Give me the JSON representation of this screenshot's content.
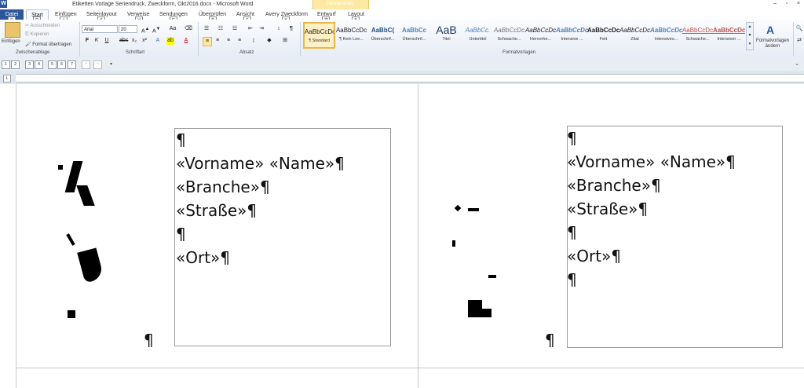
{
  "window": {
    "title": "Etiketten Vorlage Seriendruck, Zweckform, Okt2016.docx - Microsoft Word",
    "app_icon": "W",
    "context_tab_group": "Tabellentools"
  },
  "tabs": [
    {
      "label": "Datei",
      "key": "D"
    },
    {
      "label": "Start",
      "key": "R"
    },
    {
      "label": "Einfügen",
      "key": "I"
    },
    {
      "label": "Seitenlayout",
      "key": "S"
    },
    {
      "label": "Verweise",
      "key": "V"
    },
    {
      "label": "Sendungen",
      "key": "G"
    },
    {
      "label": "Überprüfen",
      "key": "P"
    },
    {
      "label": "Ansicht",
      "key": "F"
    },
    {
      "label": "Avery Zweckform",
      "key": "Y"
    },
    {
      "label": "Entwurf",
      "key": "JT"
    },
    {
      "label": "Layout",
      "key": "JL"
    }
  ],
  "ribbon": {
    "clipboard": {
      "group_label": "Zwischenablage",
      "paste": "Einfügen",
      "cut": "Ausschneiden",
      "copy": "Kopieren",
      "format_painter": "Format übertragen"
    },
    "font": {
      "group_label": "Schriftart",
      "font_name": "Arial",
      "font_size": "20"
    },
    "paragraph": {
      "group_label": "Absatz"
    },
    "styles": {
      "group_label": "Formatvorlagen",
      "items": [
        {
          "sample": "AaBbCcDc",
          "name": "¶ Standard"
        },
        {
          "sample": "AaBbCcDc",
          "name": "¶ Kein Lee..."
        },
        {
          "sample": "AaBbC(",
          "name": "Überschrif..."
        },
        {
          "sample": "AaBbCc",
          "name": "Überschrif..."
        },
        {
          "sample": "AaB",
          "name": "Titel"
        },
        {
          "sample": "AaBbCc.",
          "name": "Untertitel"
        },
        {
          "sample": "AaBbCcDc",
          "name": "Schwache..."
        },
        {
          "sample": "AaBbCcDc",
          "name": "Hervorhe..."
        },
        {
          "sample": "AaBbCcDc",
          "name": "Intensive ..."
        },
        {
          "sample": "AaBbCcDc",
          "name": "Fett"
        },
        {
          "sample": "AaBbCcDc",
          "name": "Zitat"
        },
        {
          "sample": "AaBbCcDc",
          "name": "Intensives..."
        },
        {
          "sample": "AaBbCcDc",
          "name": "Schwache..."
        },
        {
          "sample": "AaBbCcDc",
          "name": "Intensiver ..."
        }
      ],
      "change_styles": "Formatvorlagen ändern"
    }
  },
  "qat": {
    "buttons": [
      "1",
      "2",
      "3",
      "4",
      "5",
      "6",
      "7"
    ]
  },
  "document": {
    "label_left": {
      "lines": [
        "¶",
        "«Vorname» «Name»¶",
        "«Branche»¶",
        "«Straße»¶",
        "¶",
        "«Ort»¶"
      ]
    },
    "label_right": {
      "lines": [
        "¶",
        "«Vorname» «Name»¶",
        "«Branche»¶",
        "«Straße»¶",
        "¶",
        "«Ort»¶",
        "¶"
      ]
    },
    "left_pilcrow": "¶",
    "right_pilcrow": "¶"
  }
}
